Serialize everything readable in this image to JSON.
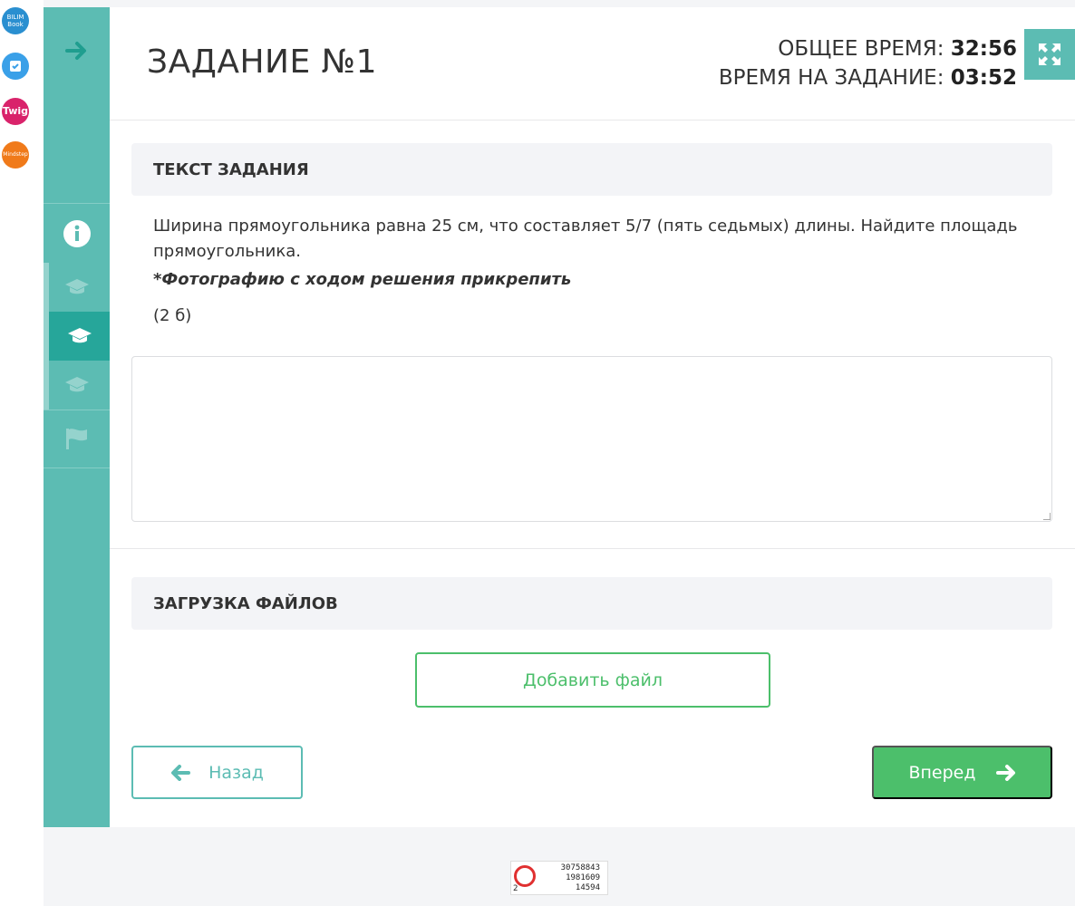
{
  "launcher": {
    "apps": [
      {
        "label": "BILIM Book"
      },
      {
        "label": "iTest"
      },
      {
        "label": "Twig"
      },
      {
        "label": "Mindstep"
      }
    ]
  },
  "header": {
    "title": "ЗАДАНИЕ №1",
    "total_time_label": "ОБЩЕЕ ВРЕМЯ:",
    "total_time_value": "32:56",
    "task_time_label": "ВРЕМЯ НА ЗАДАНИЕ:",
    "task_time_value": "03:52"
  },
  "task": {
    "section_title": "ТЕКСТ ЗАДАНИЯ",
    "text": "Ширина прямоугольника равна 25 см, что составляет 5/7 (пять седьмых) длины. Найдите площадь прямоугольника.",
    "note": "*Фотографию с ходом решения прикрепить",
    "points": "(2 б)",
    "answer_value": ""
  },
  "files": {
    "section_title": "ЗАГРУЗКА ФАЙЛОВ",
    "add_file_label": "Добавить файл"
  },
  "nav": {
    "back_label": "Назад",
    "next_label": "Вперед"
  },
  "counter": {
    "line1": "30758843",
    "line2": "1981609",
    "line3": "14594",
    "small": "2"
  },
  "colors": {
    "teal": "#5cbcb3",
    "teal_active": "#26a69a",
    "green": "#4cbf6b"
  }
}
